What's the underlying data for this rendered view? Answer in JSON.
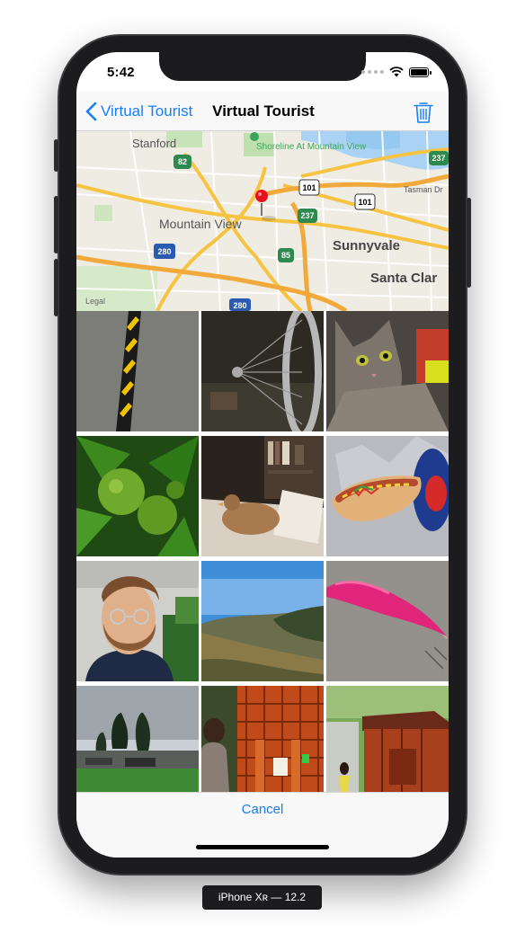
{
  "status_bar": {
    "time": "5:42",
    "icons": [
      "signal-dots-icon",
      "wifi-icon",
      "battery-icon"
    ]
  },
  "nav": {
    "back_label": "Virtual Tourist",
    "back_icon": "chevron-left-icon",
    "title": "Virtual Tourist",
    "action_icon": "trash-icon",
    "tint": "#1a7ef5"
  },
  "map": {
    "places": [
      "Stanford",
      "Shoreline At Mountain View",
      "Mountain View",
      "Sunnyvale",
      "Santa Clar",
      "Tasman Dr",
      "Legal"
    ],
    "highway_shields": [
      "82",
      "101",
      "101",
      "237",
      "237",
      "85",
      "280",
      "280"
    ],
    "pin": "red-pin-icon"
  },
  "photos": [
    {
      "subject": "road-speed-bump-photo"
    },
    {
      "subject": "bicycle-wheel-photo"
    },
    {
      "subject": "tabby-cat-photo"
    },
    {
      "subject": "green-citrus-fruit-photo"
    },
    {
      "subject": "chicken-on-bookshelf-photo"
    },
    {
      "subject": "hot-dog-photo"
    },
    {
      "subject": "bearded-man-selfie-photo"
    },
    {
      "subject": "hills-landscape-photo"
    },
    {
      "subject": "pink-feather-photo"
    },
    {
      "subject": "park-trees-photo"
    },
    {
      "subject": "child-at-cage-photo"
    },
    {
      "subject": "red-chicken-coop-photo"
    }
  ],
  "toolbar": {
    "cancel_label": "Cancel"
  },
  "simulator_label": "iPhone Xʀ — 12.2"
}
